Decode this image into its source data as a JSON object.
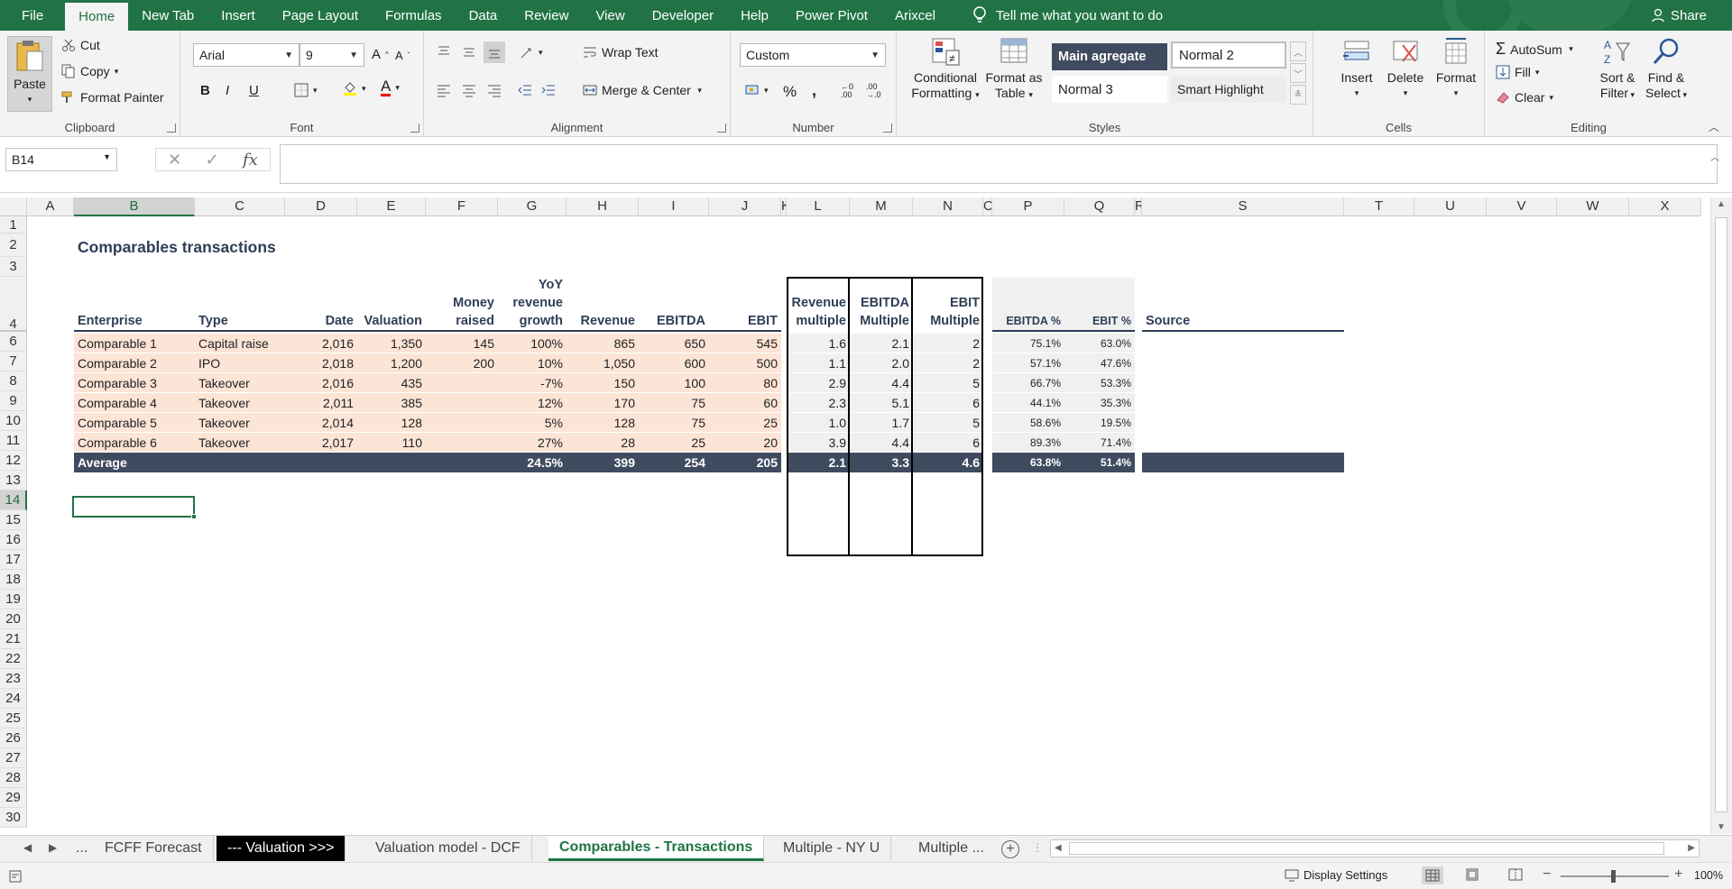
{
  "ribbon_tabs": [
    "File",
    "Home",
    "New Tab",
    "Insert",
    "Page Layout",
    "Formulas",
    "Data",
    "Review",
    "View",
    "Developer",
    "Help",
    "Power Pivot",
    "Arixcel"
  ],
  "tell_me": "Tell me what you want to do",
  "share": "Share",
  "clipboard": {
    "paste": "Paste",
    "cut": "Cut",
    "copy": "Copy",
    "format_painter": "Format Painter",
    "label": "Clipboard"
  },
  "font": {
    "name": "Arial",
    "size": "9",
    "bold": "B",
    "italic": "I",
    "underline": "U",
    "label": "Font"
  },
  "alignment": {
    "wrap": "Wrap Text",
    "merge": "Merge & Center",
    "label": "Alignment"
  },
  "number": {
    "format": "Custom",
    "pct": "%",
    "comma": ",",
    "label": "Number"
  },
  "styles": {
    "conditional": [
      "Conditional",
      "Formatting"
    ],
    "format_table": [
      "Format as",
      "Table"
    ],
    "s1": "Main agregate",
    "s2": "Normal 2",
    "s3": "Normal 3",
    "s4": "Smart Highlight",
    "label": "Styles"
  },
  "cells": {
    "insert": "Insert",
    "delete": "Delete",
    "format": "Format",
    "label": "Cells"
  },
  "editing": {
    "autosum": "AutoSum",
    "fill": "Fill",
    "clear": "Clear",
    "sort": [
      "Sort &",
      "Filter"
    ],
    "find": [
      "Find &",
      "Select"
    ],
    "label": "Editing"
  },
  "name_box": "B14",
  "columns": [
    "A",
    "B",
    "C",
    "D",
    "E",
    "F",
    "G",
    "H",
    "I",
    "J",
    "K",
    "L",
    "M",
    "N",
    "O",
    "P",
    "Q",
    "R",
    "S",
    "T",
    "U",
    "V",
    "W",
    "X"
  ],
  "rows": [
    "1",
    "2",
    "3",
    "4",
    "6",
    "7",
    "8",
    "9",
    "10",
    "11",
    "12",
    "13",
    "14",
    "15",
    "16",
    "17",
    "18",
    "19",
    "20",
    "21",
    "22",
    "23",
    "24",
    "25",
    "26",
    "27",
    "28",
    "29",
    "30"
  ],
  "sheet_title": "Comparables transactions",
  "headers": {
    "enterprise": "Enterprise",
    "type": "Type",
    "date": "Date",
    "valuation": "Valuation",
    "money": [
      "Money",
      "raised"
    ],
    "growth": [
      "YoY",
      "revenue",
      "growth"
    ],
    "revenue": "Revenue",
    "ebitda": "EBITDA",
    "ebit": "EBIT",
    "rev_mult": [
      "Revenue",
      "multiple"
    ],
    "ebitda_mult": [
      "EBITDA",
      "Multiple"
    ],
    "ebit_mult": [
      "EBIT",
      "Multiple"
    ],
    "ebitda_pct": "EBITDA %",
    "ebit_pct": "EBIT %",
    "source": "Source"
  },
  "table_rows": [
    [
      "Comparable 1",
      "Capital raise",
      "2,016",
      "1,350",
      "145",
      "100%",
      "865",
      "650",
      "545",
      "1.6",
      "2.1",
      "2",
      "75.1%",
      "63.0%"
    ],
    [
      "Comparable 2",
      "IPO",
      "2,018",
      "1,200",
      "200",
      "10%",
      "1,050",
      "600",
      "500",
      "1.1",
      "2.0",
      "2",
      "57.1%",
      "47.6%"
    ],
    [
      "Comparable 3",
      "Takeover",
      "2,016",
      "435",
      "",
      "-7%",
      "150",
      "100",
      "80",
      "2.9",
      "4.4",
      "5",
      "66.7%",
      "53.3%"
    ],
    [
      "Comparable 4",
      "Takeover",
      "2,011",
      "385",
      "",
      "12%",
      "170",
      "75",
      "60",
      "2.3",
      "5.1",
      "6",
      "44.1%",
      "35.3%"
    ],
    [
      "Comparable 5",
      "Takeover",
      "2,014",
      "128",
      "",
      "5%",
      "128",
      "75",
      "25",
      "1.0",
      "1.7",
      "5",
      "58.6%",
      "19.5%"
    ],
    [
      "Comparable 6",
      "Takeover",
      "2,017",
      "110",
      "",
      "27%",
      "28",
      "25",
      "20",
      "3.9",
      "4.4",
      "6",
      "89.3%",
      "71.4%"
    ]
  ],
  "average": [
    "Average",
    "24.5%",
    "399",
    "254",
    "205",
    "2.1",
    "3.3",
    "4.6",
    "63.8%",
    "51.4%"
  ],
  "sheet_tabs": [
    "...",
    "FCFF Forecast",
    "--- Valuation >>>",
    "Valuation model - DCF",
    "Comparables - Transactions",
    "Multiple - NY U",
    "Multiple ..."
  ],
  "status": {
    "display_settings": "Display Settings",
    "zoom": "100%"
  },
  "colors": {
    "excel_green": "#217346",
    "navy": "#3f4b5f",
    "peach": "#fce4d6",
    "grey_fill": "#f0f0f0"
  }
}
